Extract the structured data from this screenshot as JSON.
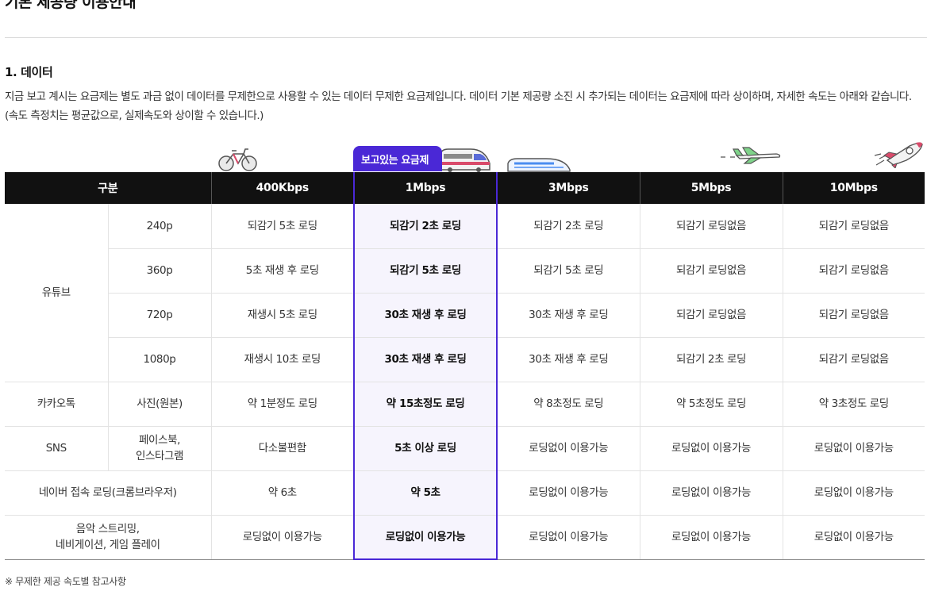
{
  "page": {
    "title": "기본 제공량 이용안내",
    "section_title": "1. 데이터",
    "description": "지금 보고 계시는 요금제는 별도 과금 없이 데이터를 무제한으로 사용할 수 있는 데이터 무제한 요금제입니다. 데이터 기본 제공량  소진 시 추가되는 데이터는 요금제에 따라 상이하며, 자세한 속도는 아래와 같습니다. (속도 측정치는 평균값으로, 실제속도와 상이할 수 있습니다.)",
    "current_badge": "보고있는 요금제",
    "footnote": "※  무제한 제공 속도별 참고사항"
  },
  "icons": [
    "bicycle-icon",
    "train-icon",
    "bullet-train-icon",
    "airplane-icon",
    "rocket-icon"
  ],
  "colors": {
    "accent": "#4a28d6",
    "header_bg": "#111111",
    "highlight_bg": "#f6f4fd"
  },
  "table": {
    "headers": [
      "구분",
      "400Kbps",
      "1Mbps",
      "3Mbps",
      "5Mbps",
      "10Mbps"
    ],
    "highlight_column": "1Mbps",
    "groups": {
      "youtube": "유튜브",
      "kakaotalk": "카카오톡",
      "sns": "SNS",
      "naver": "네이버 접속 로딩(크롬브라우저)",
      "music": "음악 스트리밍,\n네비게이션, 게임 플레이"
    },
    "rows": [
      {
        "sub": "240p",
        "values": [
          "되감기 5초 로딩",
          "되감기 2초 로딩",
          "되감기 2초 로딩",
          "되감기 로딩없음",
          "되감기 로딩없음"
        ]
      },
      {
        "sub": "360p",
        "values": [
          "5초 재생 후 로딩",
          "되감기 5초 로딩",
          "되감기 5초 로딩",
          "되감기 로딩없음",
          "되감기 로딩없음"
        ]
      },
      {
        "sub": "720p",
        "values": [
          "재생시 5초 로딩",
          "30초 재생 후 로딩",
          "30초 재생 후 로딩",
          "되감기 로딩없음",
          "되감기 로딩없음"
        ]
      },
      {
        "sub": "1080p",
        "values": [
          "재생시 10초 로딩",
          "30초 재생 후 로딩",
          "30초 재생 후 로딩",
          "되감기 2초 로딩",
          "되감기 로딩없음"
        ]
      },
      {
        "sub": "사진(원본)",
        "values": [
          "약 1분정도 로딩",
          "약 15초정도 로딩",
          "약 8초정도 로딩",
          "약 5초정도 로딩",
          "약 3초정도 로딩"
        ]
      },
      {
        "sub": "페이스북,\n인스타그램",
        "values": [
          "다소불편함",
          "5초 이상 로딩",
          "로딩없이 이용가능",
          "로딩없이 이용가능",
          "로딩없이 이용가능"
        ]
      },
      {
        "values": [
          "약 6초",
          "약 5초",
          "로딩없이 이용가능",
          "로딩없이 이용가능",
          "로딩없이 이용가능"
        ]
      },
      {
        "values": [
          "로딩없이 이용가능",
          "로딩없이 이용가능",
          "로딩없이 이용가능",
          "로딩없이 이용가능",
          "로딩없이 이용가능"
        ]
      }
    ]
  }
}
